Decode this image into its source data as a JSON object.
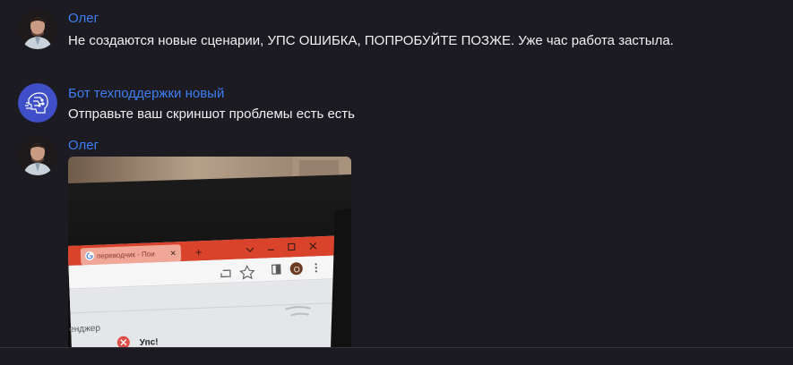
{
  "messages": [
    {
      "author": "Олег",
      "text": "Не создаются новые сценарии, УПС ОШИБКА, ПОПРОБУЙТЕ ПОЗЖЕ. Уже час работа застыла."
    },
    {
      "author": "Бот техподдержки новый",
      "text": "Отправьте ваш скриншот проблемы есть есть"
    },
    {
      "author": "Олег",
      "photo": {
        "tab_title": "переводчик - Пои",
        "tab_close": "×",
        "new_tab": "+",
        "partial_text_1": "енджер",
        "partial_text_2": "Упс!",
        "profile_badge": "О"
      }
    }
  ],
  "colors": {
    "background": "#1c1b22",
    "author_link": "#3d7ef2",
    "message_text": "#f1f1f3",
    "bot_avatar": "#3f4fc7"
  }
}
